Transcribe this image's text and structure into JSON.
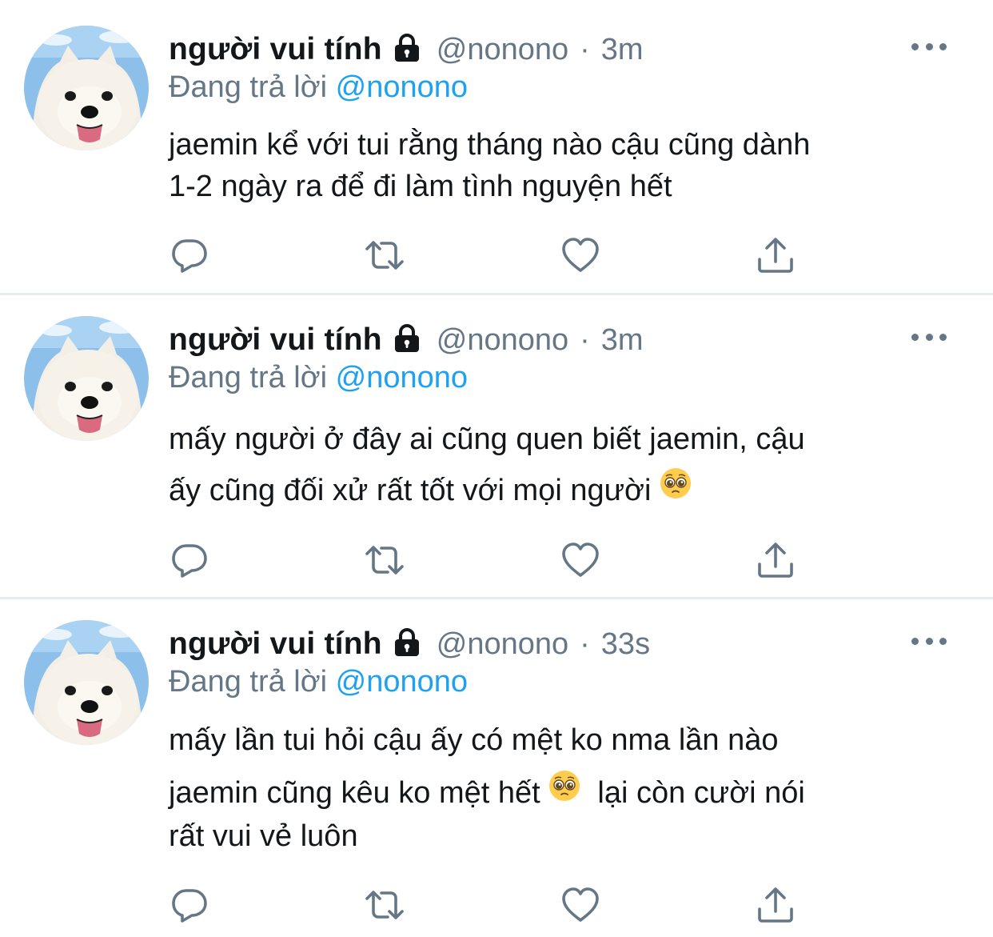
{
  "tweets": [
    {
      "name": "người vui tính",
      "handle": "@nonono",
      "separator": "·",
      "time": "3m",
      "replying_prefix": "Đang trả lời",
      "replying_to": "@nonono",
      "lines": [
        "jaemin kể với tui rằng tháng nào cậu cũng dành",
        "1-2 ngày ra để đi làm tình nguyện hết"
      ]
    },
    {
      "name": "người vui tính",
      "handle": "@nonono",
      "separator": "·",
      "time": "3m",
      "replying_prefix": "Đang trả lời",
      "replying_to": "@nonono",
      "lines": [
        "mấy người ở đây ai cũng quen biết jaemin, cậu",
        "ấy cũng đối xử rất tốt với mọi người"
      ]
    },
    {
      "name": "người vui tính",
      "handle": "@nonono",
      "separator": "·",
      "time": "33s",
      "replying_prefix": "Đang trả lời",
      "replying_to": "@nonono",
      "lines": [
        "mấy lần tui hỏi cậu ấy có mệt ko nma lần nào",
        "jaemin cũng kêu ko mệt hết",
        "lại còn cười nói",
        "rất vui vẻ luôn"
      ]
    }
  ],
  "icons": {
    "lock": "lock-icon",
    "more": "more-icon",
    "reply": "reply-icon",
    "retweet": "retweet-icon",
    "like": "like-icon",
    "share": "share-icon",
    "emoji": "pleading-face-emoji"
  },
  "colors": {
    "name": "#14171a",
    "meta": "#657786",
    "mention": "#1da1f2",
    "divider": "#e6ecf0"
  }
}
